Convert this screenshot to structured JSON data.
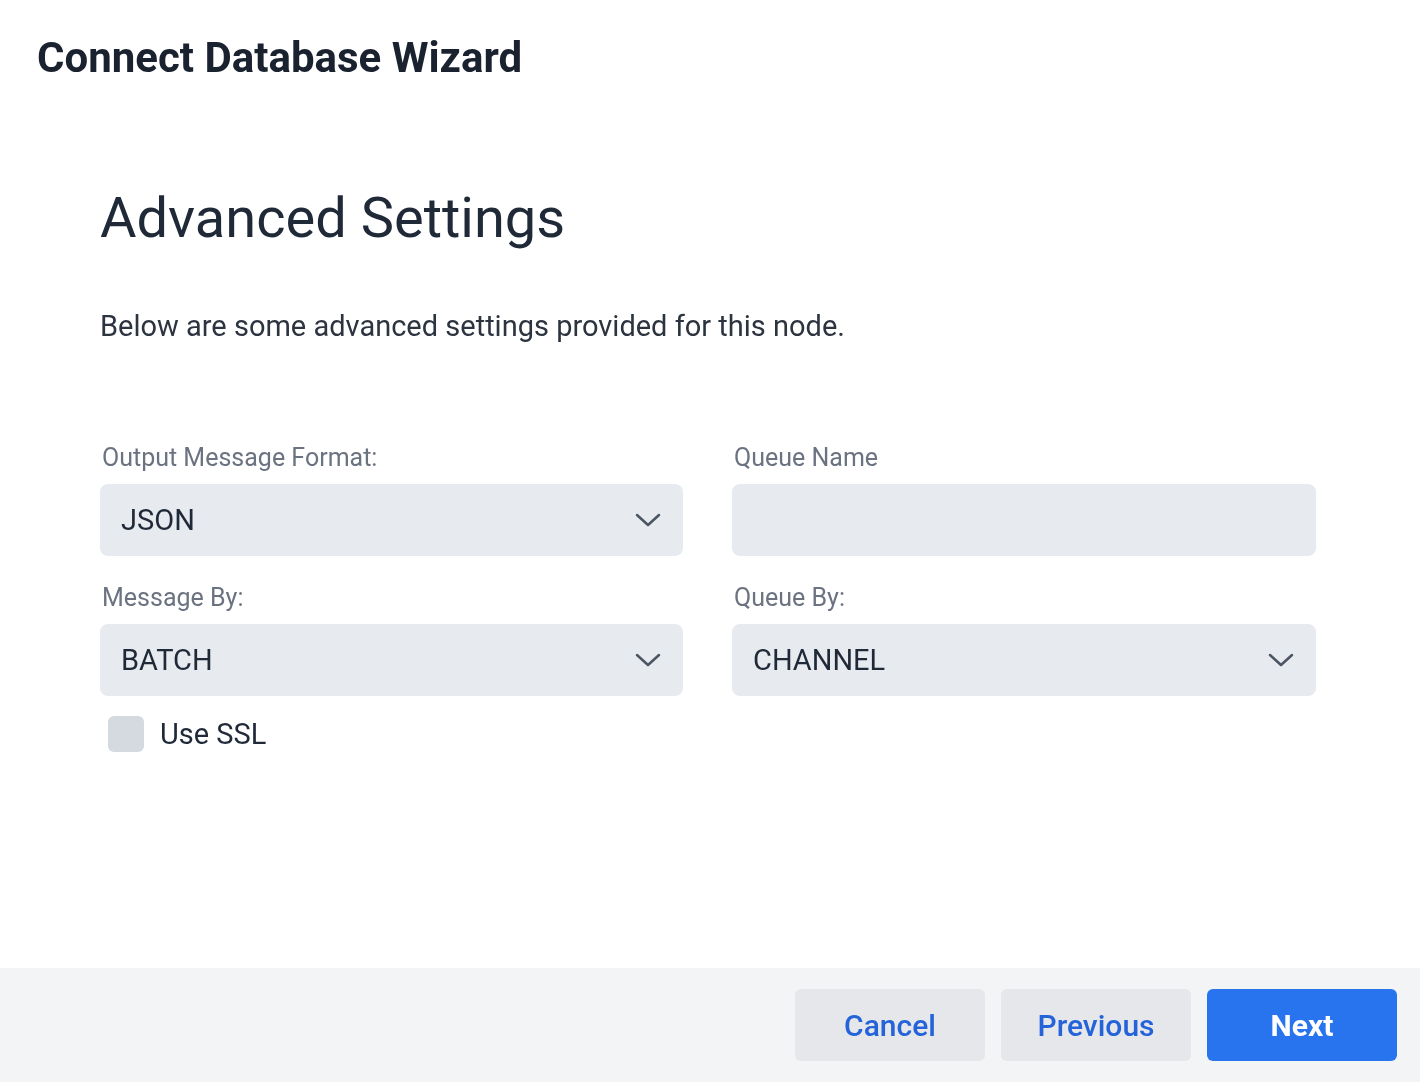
{
  "window": {
    "title": "Connect Database Wizard"
  },
  "section": {
    "heading": "Advanced Settings",
    "description": "Below are some advanced settings provided for this node."
  },
  "fields": [
    {
      "label": "Output Message Format:",
      "kind": "select",
      "value": "JSON"
    },
    {
      "label": "Queue Name",
      "kind": "text"
    },
    {
      "label": "Message By:",
      "kind": "select",
      "value": "BATCH"
    },
    {
      "label": "Queue By:",
      "kind": "select",
      "value": "CHANNEL"
    }
  ],
  "checkbox": {
    "label": "Use SSL",
    "checked": false
  },
  "buttons": [
    {
      "label": "Cancel",
      "kind": "secondary"
    },
    {
      "label": "Previous",
      "kind": "secondary"
    },
    {
      "label": "Next",
      "kind": "primary"
    }
  ]
}
